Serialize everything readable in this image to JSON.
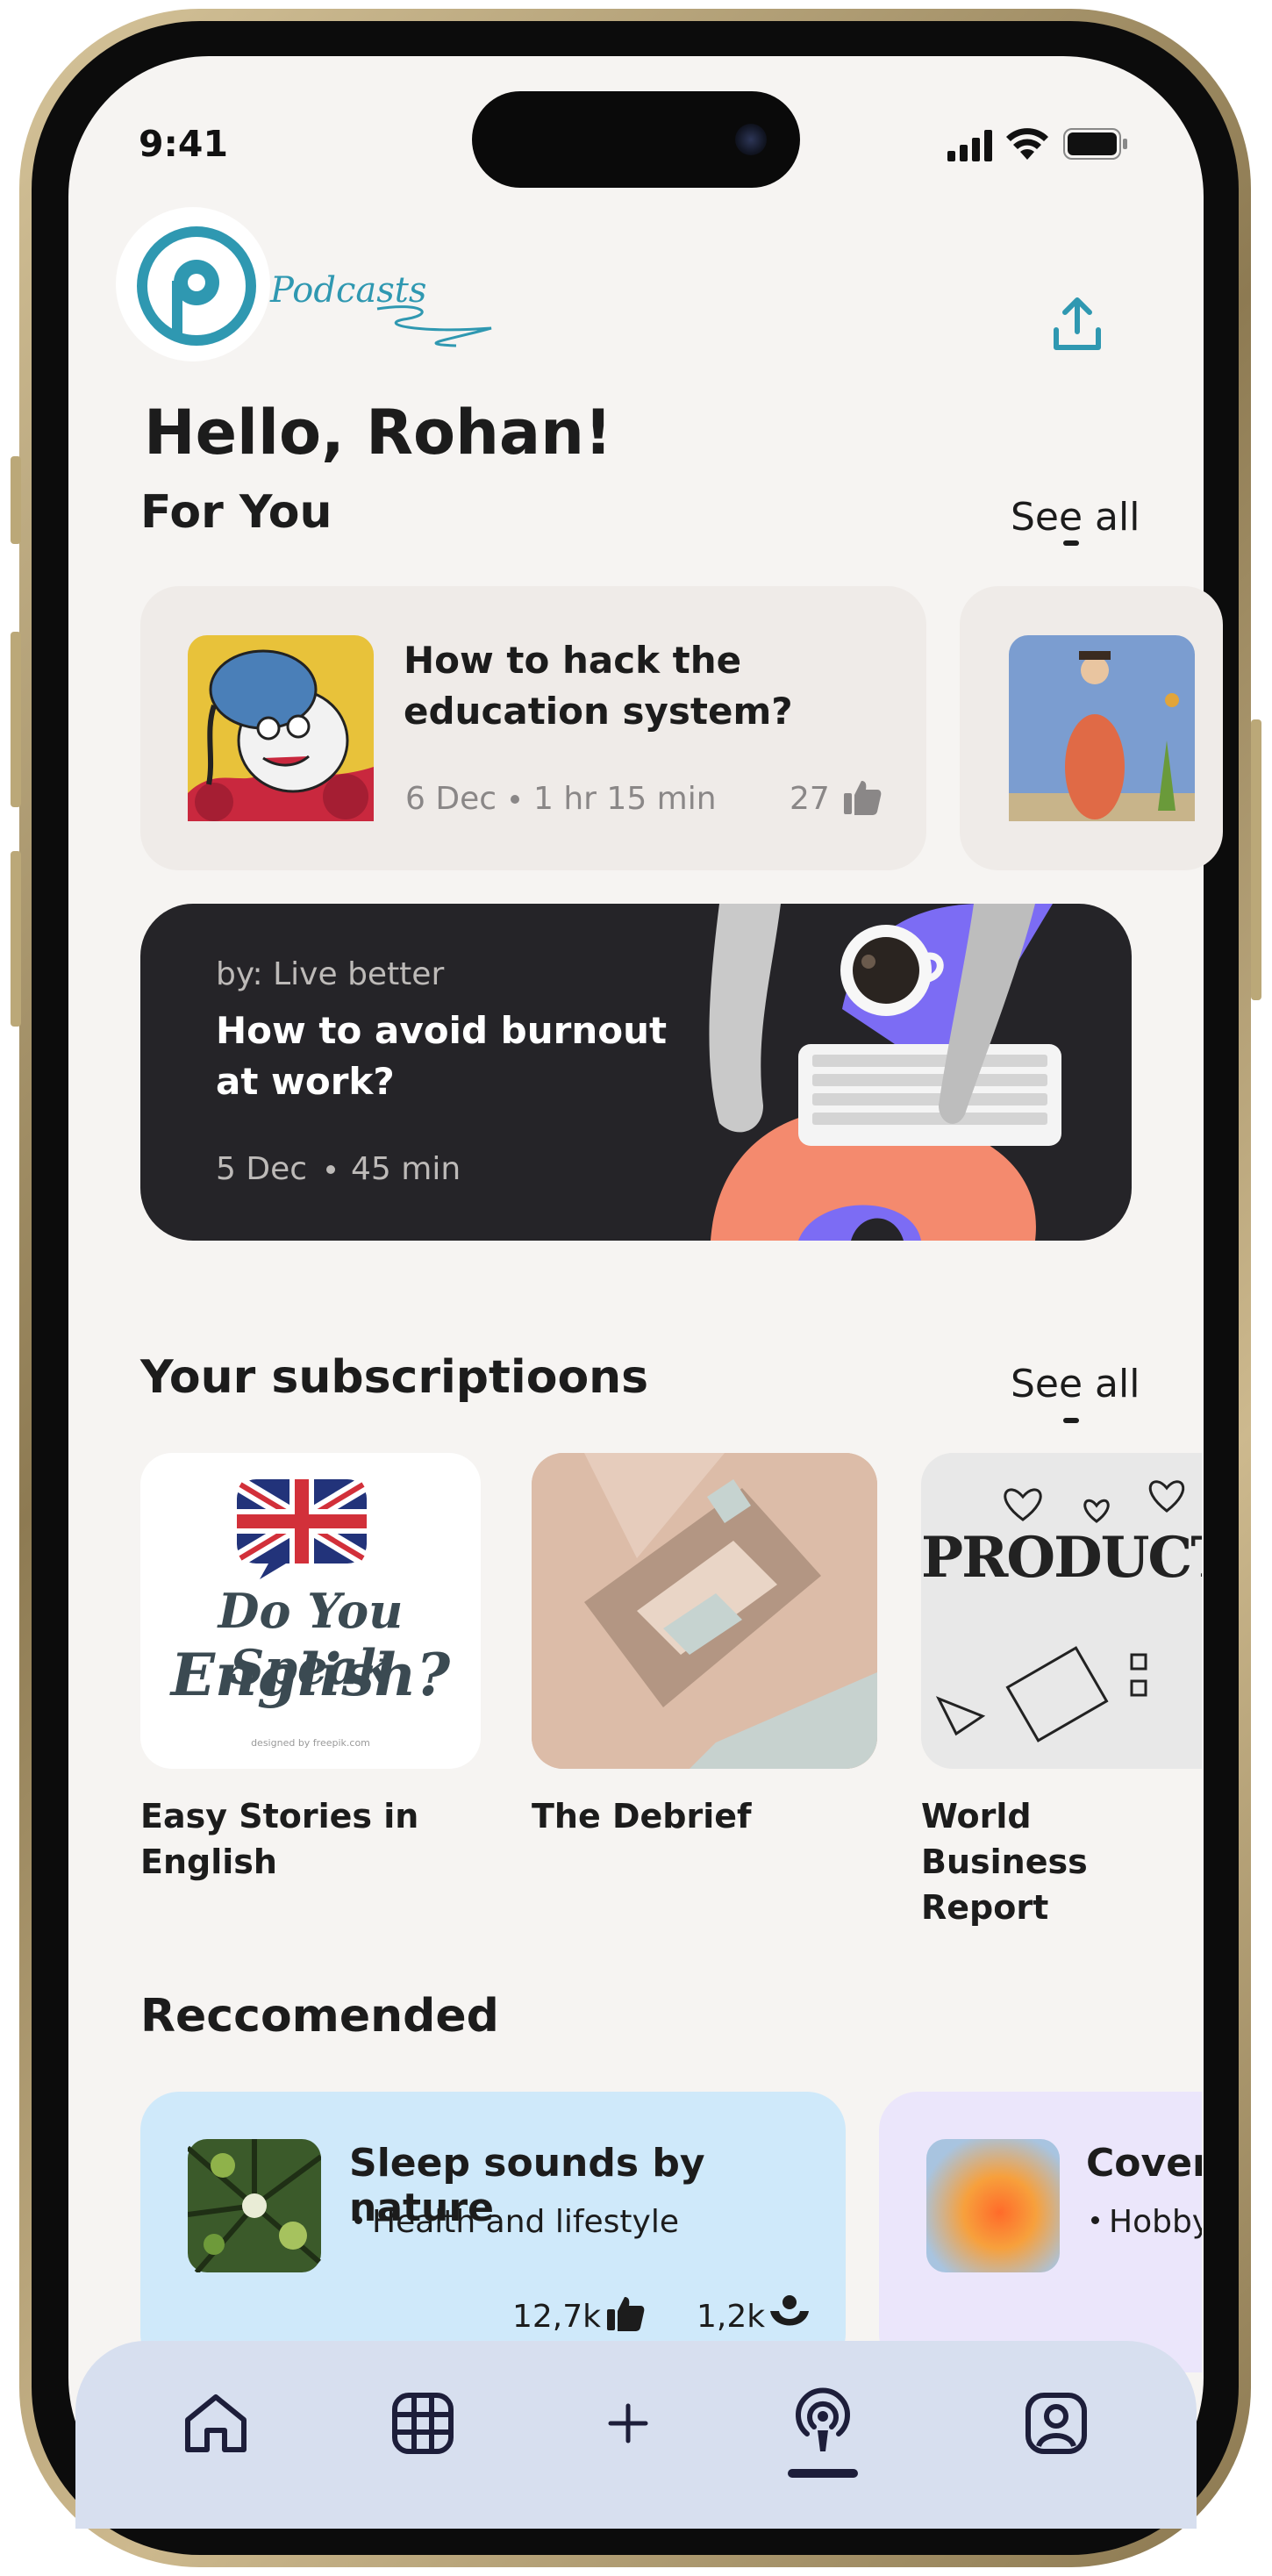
{
  "status_bar": {
    "time": "9:41"
  },
  "header": {
    "app_name": "Podcasts",
    "greeting": "Hello, Rohan!"
  },
  "for_you": {
    "title": "For You",
    "see_all": "See all",
    "cards": [
      {
        "title": "How to hack the education system?",
        "date": "6 Dec",
        "duration": "1 hr 15 min",
        "likes": "27"
      }
    ]
  },
  "featured": {
    "author": "by: Live better",
    "title": "How to avoid burnout at work?",
    "date": "5 Dec",
    "duration": "45 min"
  },
  "subscriptions": {
    "title": "Your subscriptioons",
    "see_all": "See all",
    "items": [
      {
        "name": "Easy Stories in English",
        "art_line1": "Do You Speak",
        "art_line2": "English?",
        "art_credit": "designed by freepik.com"
      },
      {
        "name": "The Debrief"
      },
      {
        "name": "World Business Report",
        "art_word": "PRODUCTIVITY"
      }
    ]
  },
  "recommended": {
    "title": "Reccomended",
    "cards": [
      {
        "title": "Sleep sounds by nature",
        "category": "Health and lifestyle",
        "likes": "12,7k",
        "listeners": "1,2k"
      },
      {
        "title": "Cover",
        "category": "Hobby"
      }
    ]
  },
  "nav": {
    "active": "podcasts"
  },
  "colors": {
    "accent": "#2f98b1",
    "dark_card": "#252428",
    "nav_bg": "#d7dfef",
    "rec_blue": "#cfe9fa",
    "rec_lilac": "#ebe6fb"
  }
}
